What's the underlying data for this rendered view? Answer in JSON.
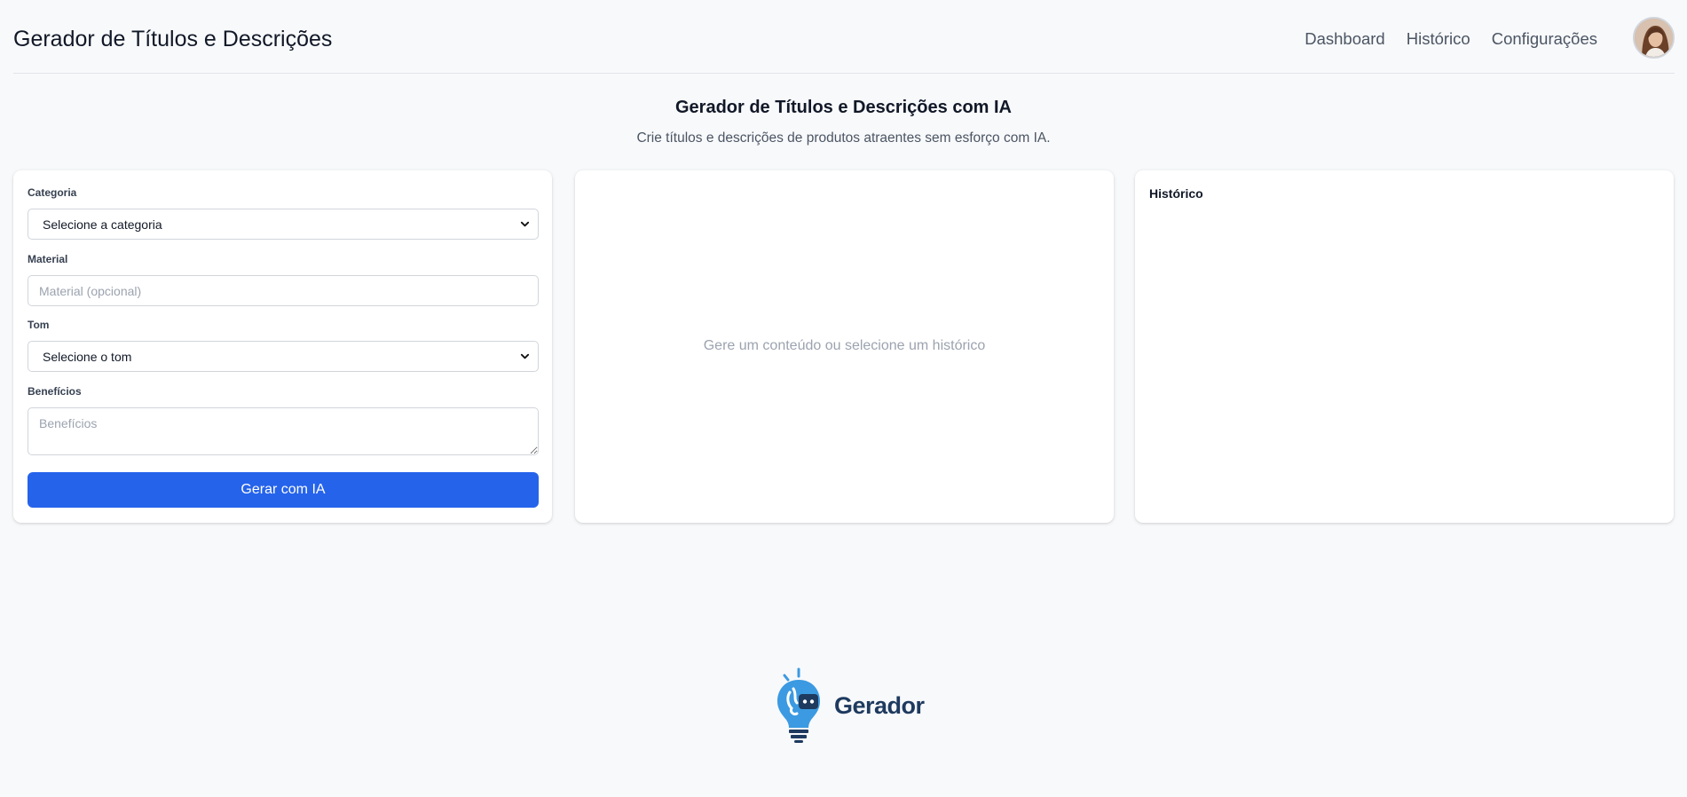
{
  "header": {
    "title": "Gerador de Títulos e Descrições",
    "nav": [
      "Dashboard",
      "Histórico",
      "Configurações"
    ]
  },
  "hero": {
    "title": "Gerador de Títulos e Descrições com IA",
    "subtitle": "Crie títulos e descrições de produtos atraentes sem esforço com IA."
  },
  "form": {
    "category_label": "Categoria",
    "category_value": "Selecione a categoria",
    "material_label": "Material",
    "material_placeholder": "Material (opcional)",
    "tone_label": "Tom",
    "tone_value": "Selecione o tom",
    "benefits_label": "Benefícios",
    "benefits_placeholder": "Benefícios",
    "submit_label": "Gerar com IA"
  },
  "result": {
    "empty_message": "Gere um conteúdo ou selecione um histórico"
  },
  "history": {
    "title": "Histórico"
  },
  "footer": {
    "brand": "Gerador"
  },
  "colors": {
    "accent": "#2563eb",
    "background": "#f8f9fb",
    "brand_dark": "#1e3a5f",
    "bulb_blue": "#3b9ae1"
  },
  "icons": [
    "chevron-down-icon",
    "avatar",
    "lightbulb-robot-logo"
  ]
}
